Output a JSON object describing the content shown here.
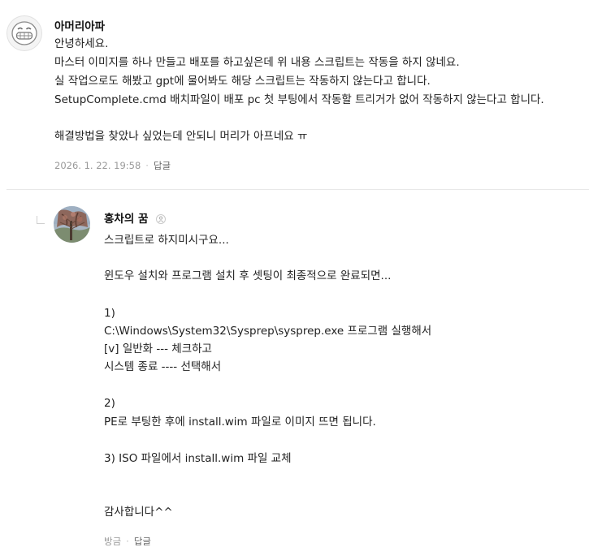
{
  "comments": [
    {
      "author": "아머리아파",
      "avatar_icon": "grinning-face-icon",
      "lines": [
        "안녕하세요.",
        "마스터 이미지를 하나 만들고 배포를 하고싶은데 위 내용 스크립트는 작동을 하지 않네요.",
        "실 작업으로도 해봤고 gpt에 물어봐도 해당 스크립트는 작동하지 않는다고 합니다.",
        "SetupComplete.cmd 배치파일이 배포 pc 첫 부팅에서 작동할 트리거가 없어 작동하지 않는다고 합니다.",
        "",
        "해결방법을 찾았나 싶었는데 안되니 머리가 아프네요 ㅠ"
      ],
      "timestamp": "2026. 1. 22. 19:58",
      "reply_label": "답글"
    },
    {
      "author": "홍차의 꿈",
      "avatar_icon": "tree-photo-icon",
      "badge_icon": "person-badge-icon",
      "lines": [
        "스크립트로 하지미시구요...",
        "",
        "윈도우 설치와 프로그램 설치 후 셋팅이 최종적으로 완료되면...",
        "",
        "1)",
        "C:\\Windows\\System32\\Sysprep\\sysprep.exe 프로그램 실행해서",
        "[v] 일반화 --- 체크하고",
        "시스템 종료 ---- 선택해서",
        "",
        "2)",
        "PE로 부팅한 후에 install.wim 파일로 이미지 뜨면 됩니다.",
        "",
        "3) ISO 파일에서 install.wim 파일 교체",
        "",
        "",
        "감사합니다^^"
      ],
      "timestamp": "방금",
      "reply_label": "답글"
    }
  ]
}
